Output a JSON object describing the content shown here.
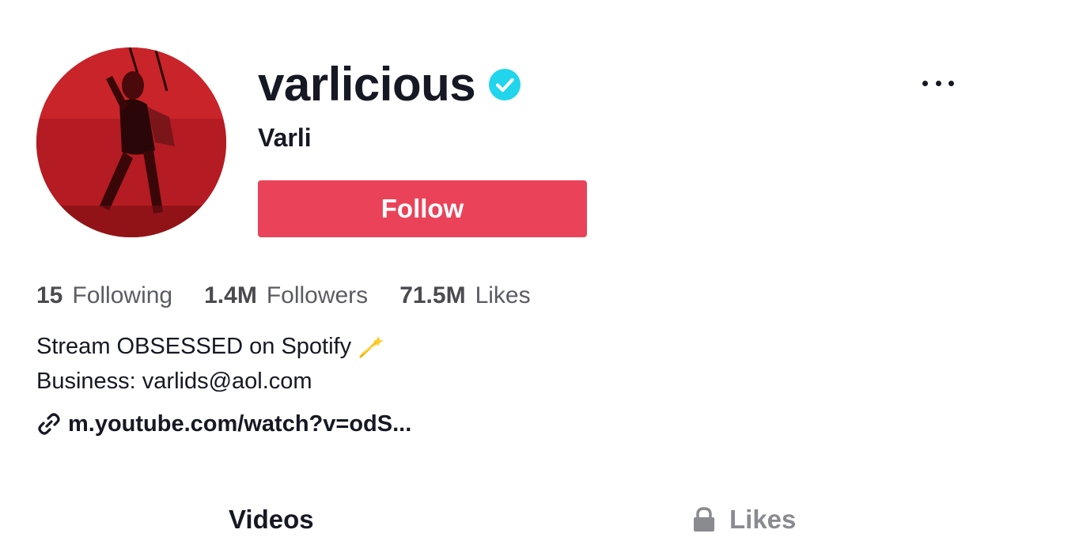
{
  "profile": {
    "username": "varlicious",
    "nickname": "Varli",
    "verified_icon": "verified-badge-icon",
    "follow_label": "Follow"
  },
  "stats": [
    {
      "value": "15",
      "label": "Following"
    },
    {
      "value": "1.4M",
      "label": "Followers"
    },
    {
      "value": "71.5M",
      "label": "Likes"
    }
  ],
  "bio": {
    "line1": "Stream OBSESSED on Spotify",
    "line1_emoji_icon": "dizzy-sparkle-icon",
    "line2": "Business: varlids@aol.com"
  },
  "link": {
    "text": "m.youtube.com/watch?v=odS...",
    "icon": "link-icon"
  },
  "tabs": [
    {
      "label": "Videos"
    },
    {
      "label": "Likes",
      "icon": "lock-icon"
    }
  ],
  "colors": {
    "follow_button": "#ea4359",
    "verified_badge": "#20d5ec",
    "text_primary": "#161823",
    "text_secondary": "#5b5c63",
    "tab_inactive": "#8a8b91"
  }
}
